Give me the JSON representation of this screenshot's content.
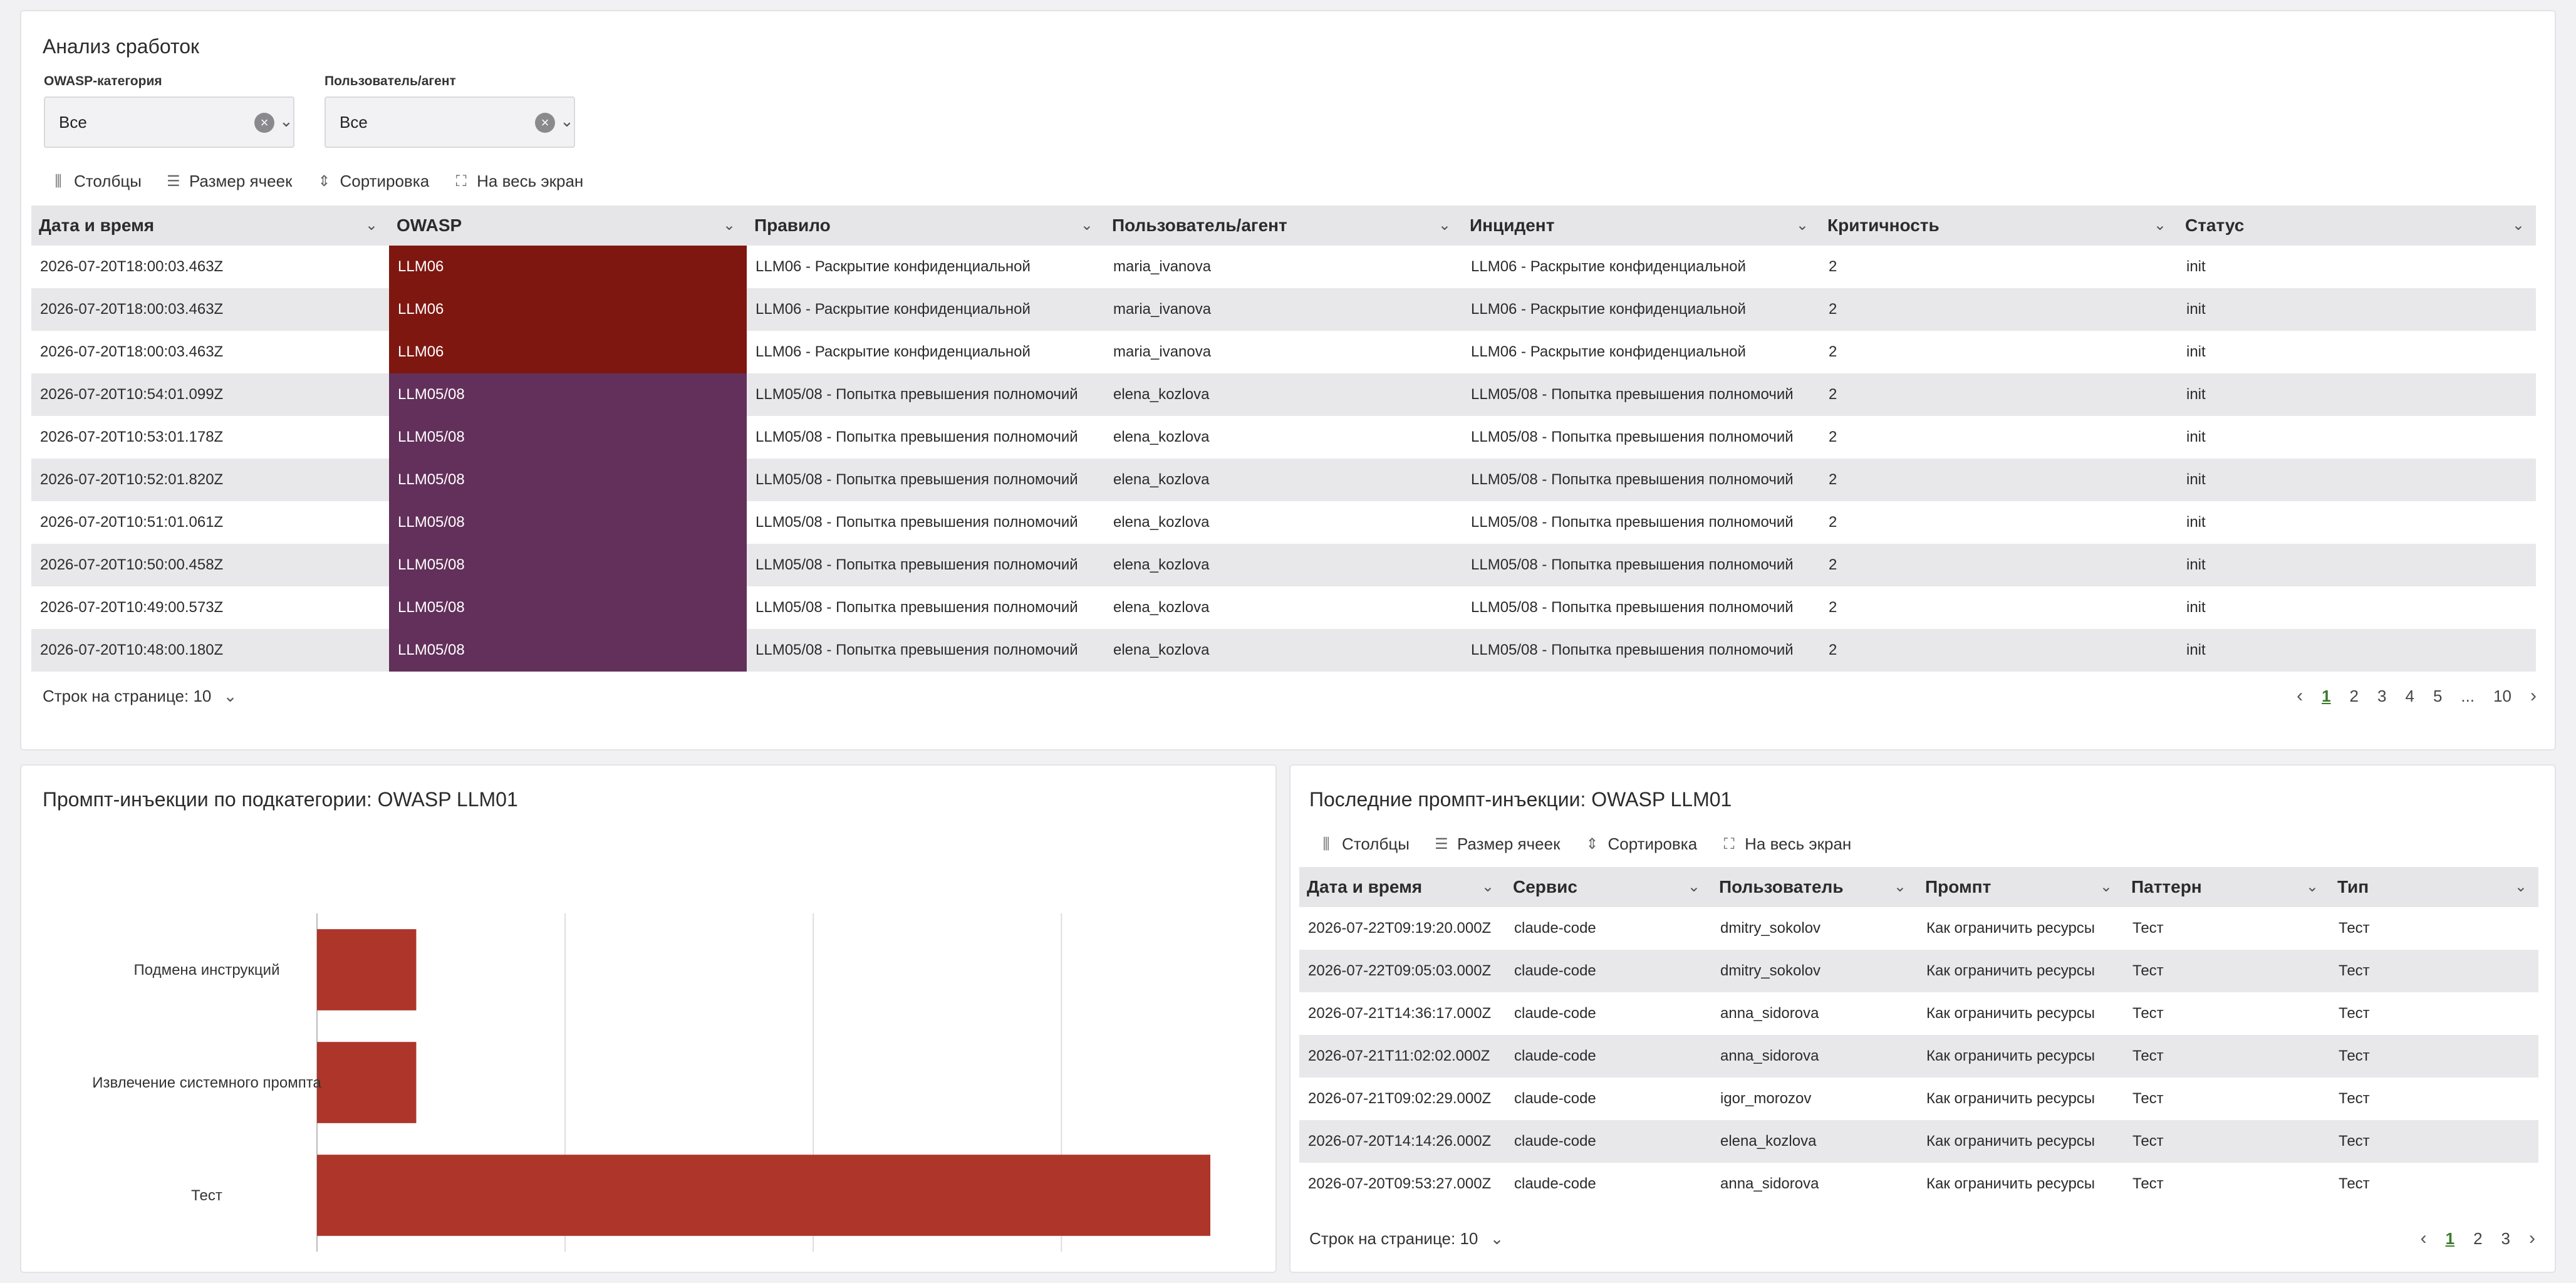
{
  "analysis": {
    "title": "Анализ сработок",
    "filters": [
      {
        "label": "OWASP-категория",
        "value": "Все"
      },
      {
        "label": "Пользователь/агент",
        "value": "Все"
      }
    ],
    "toolbar": {
      "columns": "Столбцы",
      "density": "Размер ячеек",
      "sort": "Сортировка",
      "fullscreen": "На весь экран"
    },
    "headers": [
      "Дата и время",
      "OWASP",
      "Правило",
      "Пользователь/агент",
      "Инцидент",
      "Критичность",
      "Статус"
    ],
    "owasp_colors": {
      "LLM06": "#7f1711",
      "LLM05/08": "#62305a"
    },
    "rows": [
      [
        "2026-07-20T18:00:03.463Z",
        "LLM06",
        "LLM06 - Раскрытие конфиденциальной",
        "maria_ivanova",
        "LLM06 - Раскрытие конфиденциальной",
        "2",
        "init"
      ],
      [
        "2026-07-20T18:00:03.463Z",
        "LLM06",
        "LLM06 - Раскрытие конфиденциальной",
        "maria_ivanova",
        "LLM06 - Раскрытие конфиденциальной",
        "2",
        "init"
      ],
      [
        "2026-07-20T18:00:03.463Z",
        "LLM06",
        "LLM06 - Раскрытие конфиденциальной",
        "maria_ivanova",
        "LLM06 - Раскрытие конфиденциальной",
        "2",
        "init"
      ],
      [
        "2026-07-20T10:54:01.099Z",
        "LLM05/08",
        "LLM05/08 - Попытка превышения полномочий",
        "elena_kozlova",
        "LLM05/08 - Попытка превышения полномочий",
        "2",
        "init"
      ],
      [
        "2026-07-20T10:53:01.178Z",
        "LLM05/08",
        "LLM05/08 - Попытка превышения полномочий",
        "elena_kozlova",
        "LLM05/08 - Попытка превышения полномочий",
        "2",
        "init"
      ],
      [
        "2026-07-20T10:52:01.820Z",
        "LLM05/08",
        "LLM05/08 - Попытка превышения полномочий",
        "elena_kozlova",
        "LLM05/08 - Попытка превышения полномочий",
        "2",
        "init"
      ],
      [
        "2026-07-20T10:51:01.061Z",
        "LLM05/08",
        "LLM05/08 - Попытка превышения полномочий",
        "elena_kozlova",
        "LLM05/08 - Попытка превышения полномочий",
        "2",
        "init"
      ],
      [
        "2026-07-20T10:50:00.458Z",
        "LLM05/08",
        "LLM05/08 - Попытка превышения полномочий",
        "elena_kozlova",
        "LLM05/08 - Попытка превышения полномочий",
        "2",
        "init"
      ],
      [
        "2026-07-20T10:49:00.573Z",
        "LLM05/08",
        "LLM05/08 - Попытка превышения полномочий",
        "elena_kozlova",
        "LLM05/08 - Попытка превышения полномочий",
        "2",
        "init"
      ],
      [
        "2026-07-20T10:48:00.180Z",
        "LLM05/08",
        "LLM05/08 - Попытка превышения полномочий",
        "elena_kozlova",
        "LLM05/08 - Попытка превышения полномочий",
        "2",
        "init"
      ]
    ],
    "rows_per_page": "Строк на странице: 10",
    "pages": [
      "1",
      "2",
      "3",
      "4",
      "5",
      "...",
      "10"
    ],
    "active_page": "1"
  },
  "injections_chart": {
    "title": "Промпт-инъекции по подкатегории: OWASP LLM01"
  },
  "chart_data": {
    "type": "bar",
    "orientation": "horizontal",
    "title": "Промпт-инъекции по подкатегории: OWASP LLM01",
    "categories": [
      "Подмена инструкций",
      "Извлечение системного промпта",
      "Тест"
    ],
    "values": [
      2,
      2,
      18
    ],
    "xticks": [
      0,
      5,
      10,
      15
    ],
    "xlim": [
      0,
      18
    ],
    "grid": true,
    "bar_color": "#ad352a"
  },
  "recent": {
    "title": "Последние промпт-инъекции: OWASP LLM01",
    "toolbar": {
      "columns": "Столбцы",
      "density": "Размер ячеек",
      "sort": "Сортировка",
      "fullscreen": "На весь экран"
    },
    "headers": [
      "Дата и время",
      "Сервис",
      "Пользователь",
      "Промпт",
      "Паттерн",
      "Тип"
    ],
    "rows": [
      [
        "2026-07-22T09:19:20.000Z",
        "claude-code",
        "dmitry_sokolov",
        "Как ограничить ресурсы",
        "Тест",
        "Тест"
      ],
      [
        "2026-07-22T09:05:03.000Z",
        "claude-code",
        "dmitry_sokolov",
        "Как ограничить ресурсы",
        "Тест",
        "Тест"
      ],
      [
        "2026-07-21T14:36:17.000Z",
        "claude-code",
        "anna_sidorova",
        "Как ограничить ресурсы",
        "Тест",
        "Тест"
      ],
      [
        "2026-07-21T11:02:02.000Z",
        "claude-code",
        "anna_sidorova",
        "Как ограничить ресурсы",
        "Тест",
        "Тест"
      ],
      [
        "2026-07-21T09:02:29.000Z",
        "claude-code",
        "igor_morozov",
        "Как ограничить ресурсы",
        "Тест",
        "Тест"
      ],
      [
        "2026-07-20T14:14:26.000Z",
        "claude-code",
        "elena_kozlova",
        "Как ограничить ресурсы",
        "Тест",
        "Тест"
      ],
      [
        "2026-07-20T09:53:27.000Z",
        "claude-code",
        "anna_sidorova",
        "Как ограничить ресурсы",
        "Тест",
        "Тест"
      ]
    ],
    "rows_per_page": "Строк на странице: 10",
    "pages": [
      "1",
      "2",
      "3"
    ],
    "active_page": "1"
  }
}
